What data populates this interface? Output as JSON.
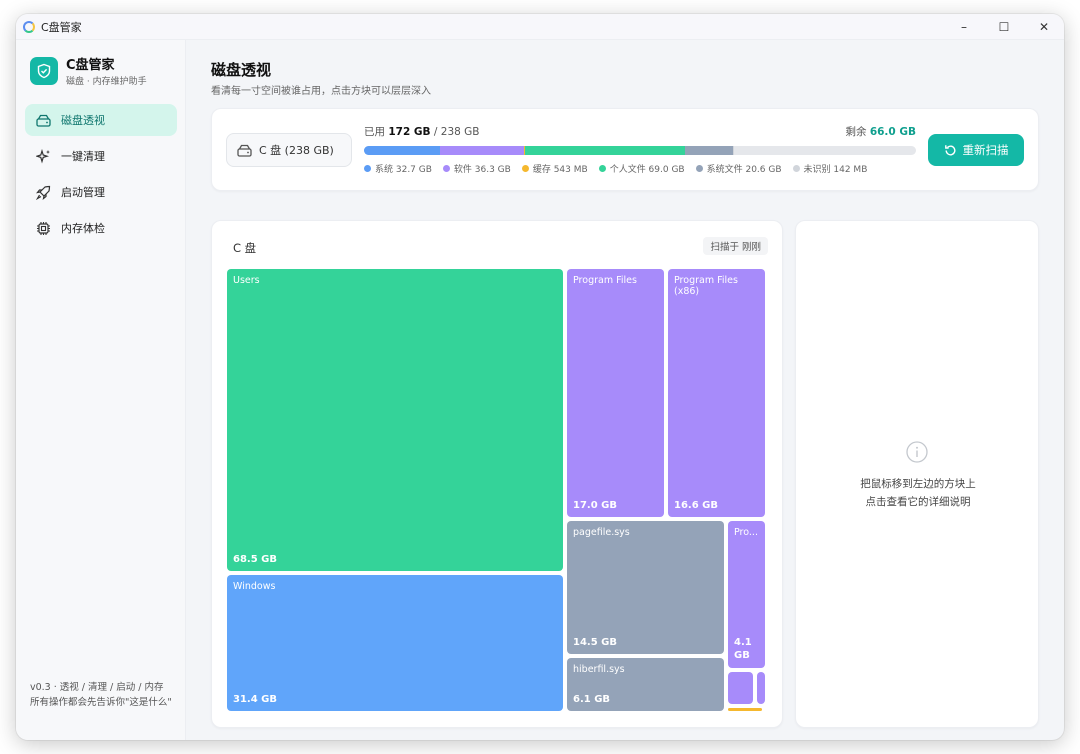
{
  "window": {
    "title": "C盘管家",
    "minimize": "–",
    "maximize": "☐",
    "close": "✕"
  },
  "brand": {
    "name": "C盘管家",
    "subtitle": "磁盘 · 内存维护助手"
  },
  "nav": [
    {
      "label": "磁盘透视",
      "icon": "drive-icon",
      "active": true
    },
    {
      "label": "一键清理",
      "icon": "sparkle-icon",
      "active": false
    },
    {
      "label": "启动管理",
      "icon": "rocket-icon",
      "active": false
    },
    {
      "label": "内存体检",
      "icon": "chip-icon",
      "active": false
    }
  ],
  "footer": {
    "version_line": "v0.3 · 透视 / 清理 / 启动 / 内存",
    "note": "所有操作都会先告诉你\"这是什么\""
  },
  "page": {
    "title": "磁盘透视",
    "subtitle": "看清每一寸空间被谁占用，点击方块可以层层深入"
  },
  "drive": {
    "selector_label": "C 盘 (238 GB)",
    "used_prefix": "已用",
    "used_value": "172 GB",
    "total_text": "/ 238 GB",
    "free_prefix": "剩余",
    "free_value": "66.0 GB",
    "total_gb": 238,
    "rescan_label": "重新扫描"
  },
  "usage_breakdown": [
    {
      "label": "系统 32.7 GB",
      "gb": 32.7,
      "color": "#5b9cf5"
    },
    {
      "label": "软件 36.3 GB",
      "gb": 36.3,
      "color": "#a78bfa"
    },
    {
      "label": "缓存 543 MB",
      "gb": 0.543,
      "color": "#f5b82e"
    },
    {
      "label": "个人文件 69.0 GB",
      "gb": 69.0,
      "color": "#34d399"
    },
    {
      "label": "系统文件 20.6 GB",
      "gb": 20.6,
      "color": "#94a3b8"
    },
    {
      "label": "未识别 142 MB",
      "gb": 0.142,
      "color": "#d1d5db"
    }
  ],
  "treemap": {
    "title": "C 盘",
    "scan_badge": "扫描于 刚刚",
    "tiles": [
      {
        "name": "Users",
        "size": "68.5 GB",
        "color": "#34d399"
      },
      {
        "name": "Windows",
        "size": "31.4 GB",
        "color": "#60a5fa"
      },
      {
        "name": "Program Files",
        "size": "17.0 GB",
        "color": "#a78bfa"
      },
      {
        "name": "Program Files (x86)",
        "size": "16.6 GB",
        "color": "#a78bfa"
      },
      {
        "name": "pagefile.sys",
        "size": "14.5 GB",
        "color": "#94a3b8"
      },
      {
        "name": "hiberfil.sys",
        "size": "6.1 GB",
        "color": "#94a3b8"
      },
      {
        "name": "Pro...",
        "size": "4.1 GB",
        "color": "#a78bfa"
      },
      {
        "name": "",
        "size": "",
        "color": "#a78bfa"
      },
      {
        "name": "",
        "size": "",
        "color": "#a78bfa"
      },
      {
        "name": "",
        "size": "",
        "color": "#f5b82e"
      }
    ]
  },
  "info_panel": {
    "line1": "把鼠标移到左边的方块上",
    "line2": "点击查看它的详细说明"
  }
}
